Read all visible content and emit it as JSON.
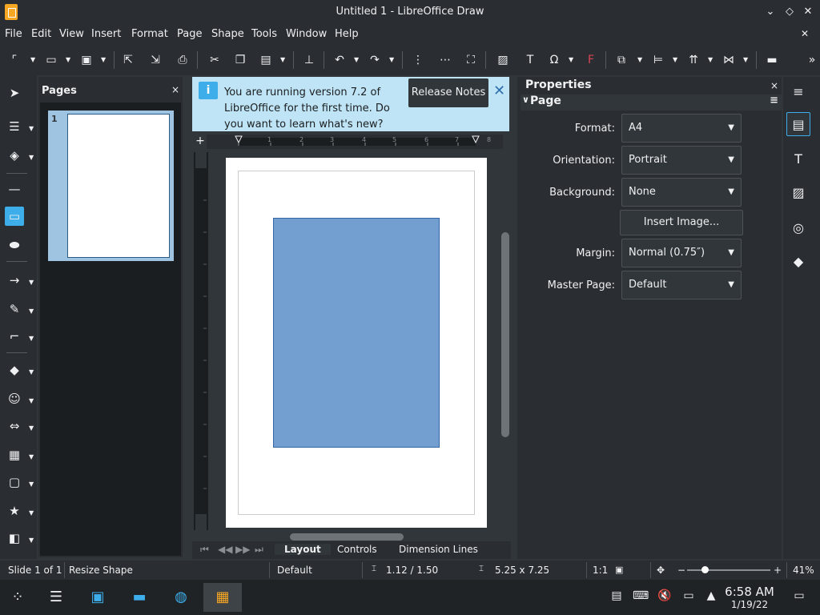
{
  "window": {
    "title": "Untitled 1 - LibreOffice Draw",
    "min": "⌄",
    "max": "◇",
    "close": "✕",
    "doc_close": "✕"
  },
  "menu": [
    "File",
    "Edit",
    "View",
    "Insert",
    "Format",
    "Page",
    "Shape",
    "Tools",
    "Window",
    "Help"
  ],
  "toolbar": {
    "more": "»"
  },
  "pages_panel": {
    "title": "Pages",
    "close": "×",
    "page_number": "1"
  },
  "infobar": {
    "message": "You are running version 7.2 of LibreOffice for the first time. Do you want to learn what's new?",
    "release_notes": "Release Notes",
    "close": "✕"
  },
  "ruler": {
    "marks": [
      "1",
      "2",
      "3",
      "4",
      "5",
      "6",
      "7",
      "8"
    ]
  },
  "layer_tabs": [
    "Layout",
    "Controls",
    "Dimension Lines"
  ],
  "properties": {
    "title": "Properties",
    "close": "×",
    "menu": "≡",
    "section": "Page",
    "format_label": "Format:",
    "format_value": "A4",
    "orientation_label": "Orientation:",
    "orientation_value": "Portrait",
    "background_label": "Background:",
    "background_value": "None",
    "insert_image": "Insert Image...",
    "margin_label": "Margin:",
    "margin_value": "Normal (0.75″)",
    "master_label": "Master Page:",
    "master_value": "Default"
  },
  "status": {
    "slide": "Slide 1 of 1",
    "action": "Resize Shape",
    "master": "Default",
    "position": "1.12 / 1.50",
    "size": "5.25 x 7.25",
    "scale": "1:1",
    "zoom": "41%",
    "zoom_minus": "−",
    "zoom_plus": "+"
  },
  "taskbar": {
    "time": "6:58 AM",
    "date": "1/19/22"
  },
  "colors": {
    "accent": "#3daee9",
    "shape_fill": "#729fcf",
    "infobar": "#bfe4f5"
  }
}
